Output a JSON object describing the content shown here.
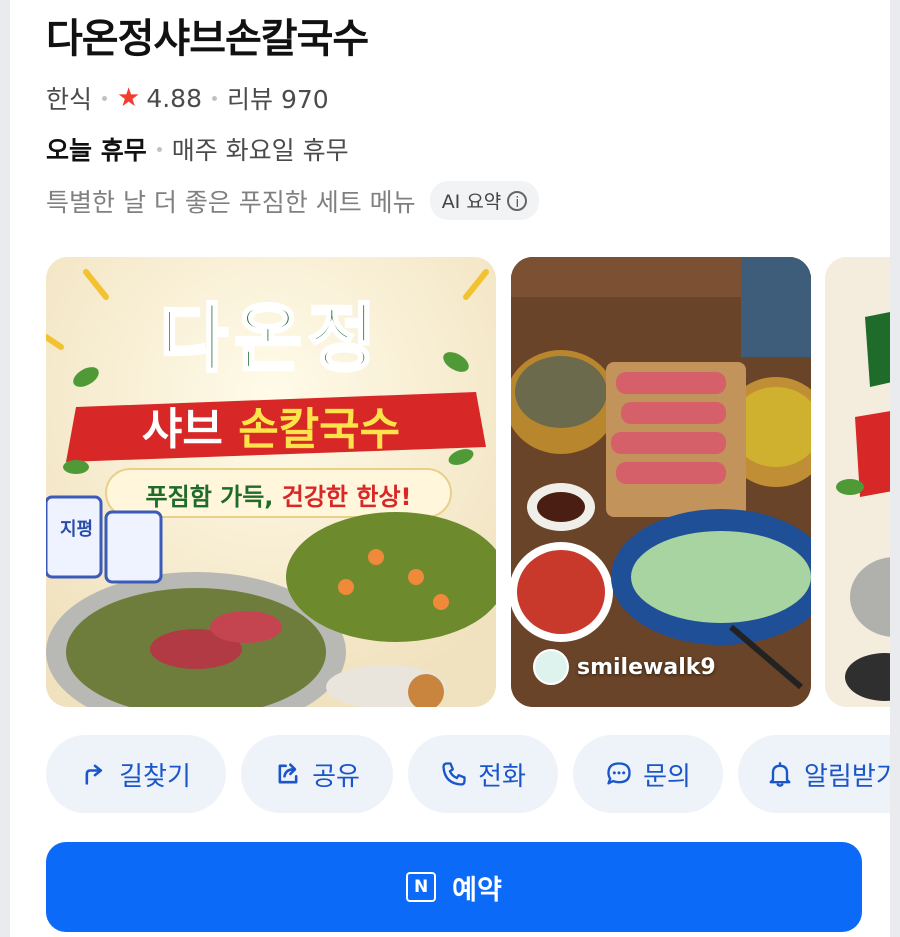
{
  "place": {
    "name": "다온정샤브손칼국수",
    "category": "한식",
    "rating": "4.88",
    "review_label": "리뷰 970",
    "status": "오늘 휴무",
    "closed_info": "매주 화요일 휴무",
    "summary": "특별한 날 더 좋은 푸짐한 세트 메뉴",
    "ai_badge": "AI 요약"
  },
  "gallery": {
    "poster": {
      "headline": "다온정",
      "sub_left": "샤브",
      "sub_right": "손칼국수",
      "tagline_a": "푸짐함 가득,",
      "tagline_b": "건강한 한상!",
      "bottle_label": "지평"
    },
    "photo2_uploader": "smilewalk9"
  },
  "actions": [
    {
      "label": "길찾기",
      "icon": "directions-icon"
    },
    {
      "label": "공유",
      "icon": "share-icon"
    },
    {
      "label": "전화",
      "icon": "phone-icon"
    },
    {
      "label": "문의",
      "icon": "chat-icon"
    },
    {
      "label": "알림받기",
      "icon": "bell-icon"
    }
  ],
  "reserve": {
    "label": "예약",
    "icon": "naver-booking-icon"
  },
  "colors": {
    "accent": "#0b6af7",
    "action_text": "#1b56c9",
    "action_bg": "#eef3fa",
    "star": "#f03e2f"
  }
}
